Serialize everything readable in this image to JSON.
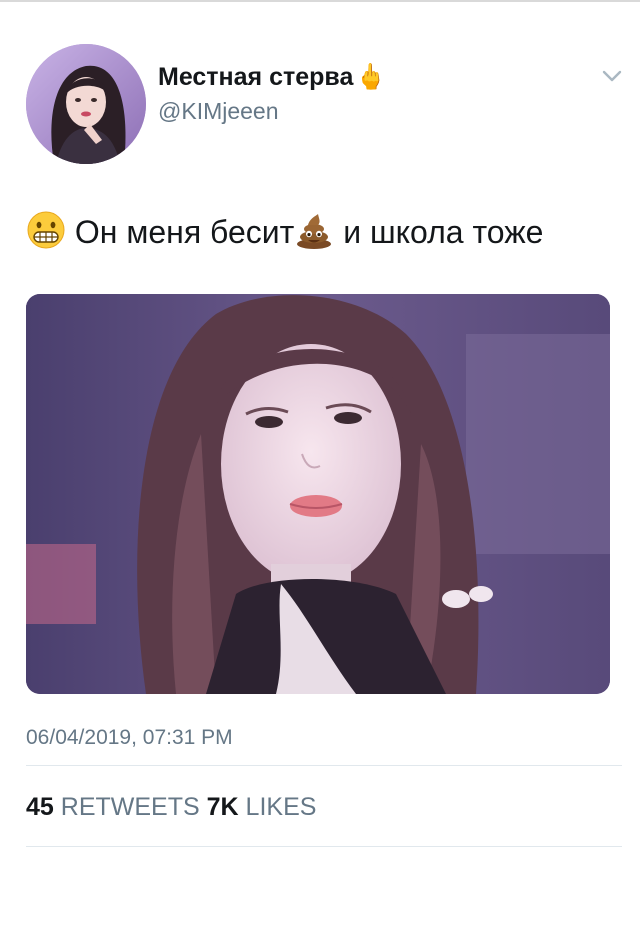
{
  "tweet": {
    "display_name": "Местная стерва",
    "display_name_emoji": "🖕",
    "handle": "@KIMjeeen",
    "text_part1": "Он меня бесит",
    "text_part2": "и школа тоже",
    "timestamp": "06/04/2019, 07:31 PM",
    "retweets_count": "45",
    "retweets_label": "RETWEETS",
    "likes_count": "7K",
    "likes_label": "LIKES",
    "icons": {
      "menu": "chevron-down-icon",
      "emoji_1": "grimacing-face-emoji",
      "emoji_2": "pile-of-poo-emoji",
      "emoji_name": "middle-finger-emoji"
    },
    "colors": {
      "text": "#14171a",
      "secondary": "#657786",
      "divider": "#e1e8ed"
    }
  }
}
